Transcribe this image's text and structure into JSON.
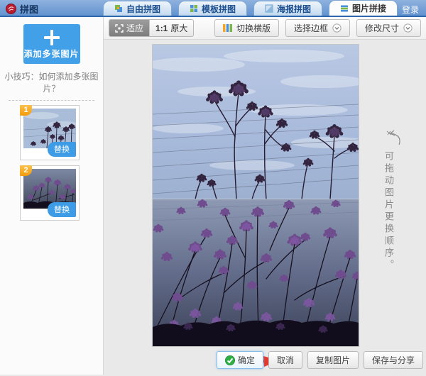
{
  "header": {
    "logo_text": "拼图",
    "login_label": "登录",
    "tabs": [
      {
        "label": "自由拼图",
        "active": false
      },
      {
        "label": "模板拼图",
        "active": false
      },
      {
        "label": "海报拼图",
        "active": false
      },
      {
        "label": "图片拼接",
        "active": true
      }
    ]
  },
  "toolbar": {
    "fit_label": "适应",
    "original_ratio": "1:1",
    "original_label": "原大",
    "switch_horizontal_label": "切换横版",
    "select_border_label": "选择边框",
    "resize_label": "修改尺寸"
  },
  "sidebar": {
    "add_button_label": "添加多张图片",
    "tip_text": "小技巧：如何添加多张图片？",
    "thumbnails": [
      {
        "index": "1",
        "replace_label": "替换"
      },
      {
        "index": "2",
        "replace_label": "替换"
      }
    ]
  },
  "canvas": {
    "note_text": "可拖动图片更换顺序。"
  },
  "footer": {
    "confirm_label": "确定",
    "cancel_label": "取消",
    "copy_label": "复制图片",
    "save_share_label": "保存与分享"
  },
  "colors": {
    "accent_blue": "#3d9ce5",
    "badge_orange": "#f49b0b",
    "confirm_green": "#2fae46",
    "arrow_red": "#e23b2e",
    "header_blue": "#6293cf"
  }
}
